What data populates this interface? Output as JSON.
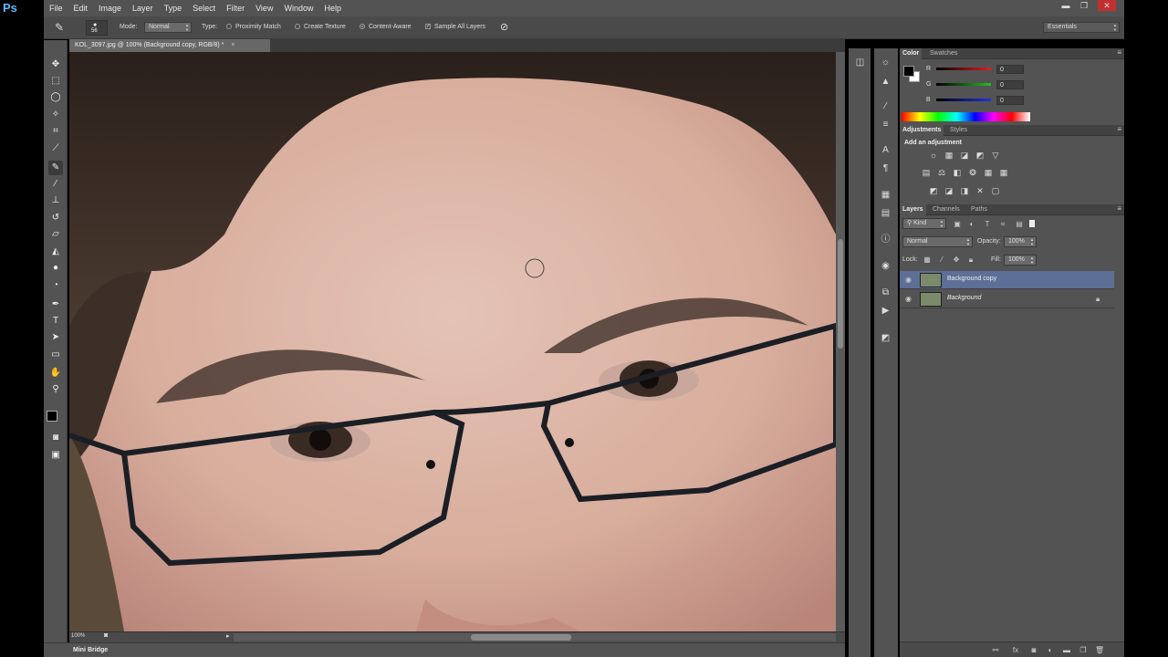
{
  "app": {
    "logo": "Ps"
  },
  "menu": [
    "File",
    "Edit",
    "Image",
    "Layer",
    "Type",
    "Select",
    "Filter",
    "View",
    "Window",
    "Help"
  ],
  "window_controls": {
    "minimize": "▬",
    "restore": "❐",
    "close": "✕"
  },
  "options": {
    "brush_size": "56",
    "mode_label": "Mode:",
    "mode_value": "Normal",
    "type_label": "Type:",
    "proximity_match": "Proximity Match",
    "create_texture": "Create Texture",
    "content_aware": "Content-Aware",
    "sample_all_layers": "Sample All Layers",
    "workspace": "Essentials"
  },
  "document": {
    "tab_title": "KOL_3097.jpg @ 100% (Background copy, RGB/8) *",
    "zoom": "100%",
    "minibridge": "Mini Bridge"
  },
  "color_panel": {
    "tabs": [
      "Color",
      "Swatches"
    ],
    "channels": [
      {
        "label": "R",
        "value": "0",
        "color": "#e02020"
      },
      {
        "label": "G",
        "value": "0",
        "color": "#20c020"
      },
      {
        "label": "B",
        "value": "0",
        "color": "#2030e0"
      }
    ]
  },
  "adjustments_panel": {
    "tabs": [
      "Adjustments",
      "Styles"
    ],
    "heading": "Add an adjustment",
    "row1": [
      "☼",
      "▦",
      "◪",
      "◩",
      "▽"
    ],
    "row2": [
      "▤",
      "⚖",
      "◧",
      "❂",
      "▦"
    ],
    "row3": [
      "◩",
      "◪",
      "◨",
      "✕",
      "▢"
    ]
  },
  "layers_panel": {
    "tabs": [
      "Layers",
      "Channels",
      "Paths"
    ],
    "kind": "Kind",
    "blend_mode": "Normal",
    "opacity_label": "Opacity:",
    "opacity": "100%",
    "lock_label": "Lock:",
    "fill_label": "Fill:",
    "fill": "100%",
    "layers": [
      {
        "name": "Background copy",
        "selected": true
      },
      {
        "name": "Background",
        "selected": false,
        "locked": true
      }
    ]
  }
}
